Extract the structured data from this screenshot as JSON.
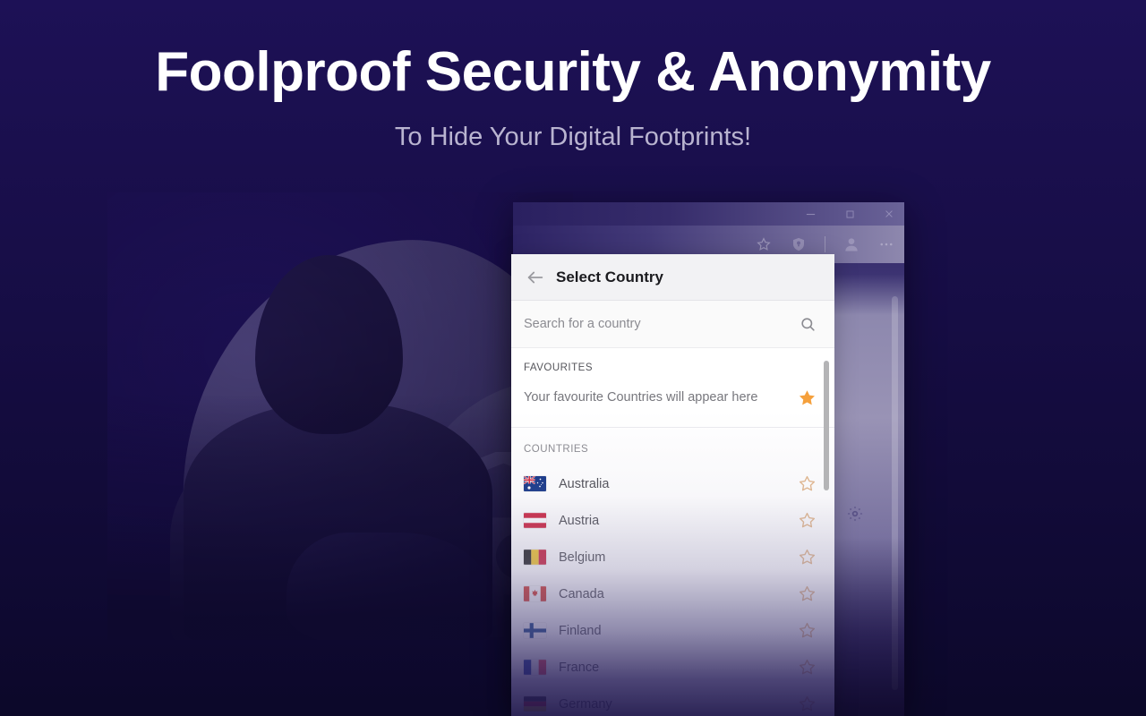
{
  "hero": {
    "title": "Foolproof Security & Anonymity",
    "subtitle": "To Hide Your Digital Footprints!"
  },
  "colors": {
    "background_top": "#1d1156",
    "background_bottom": "#0c0829",
    "star_filled": "#f5a03c",
    "star_empty": "#e0b183",
    "panel_background": "#ffffff",
    "header_background": "#f2f2f4"
  },
  "browser": {
    "window_controls": [
      {
        "name": "minimize",
        "glyph": "–"
      },
      {
        "name": "maximize",
        "glyph": "❐"
      },
      {
        "name": "close",
        "glyph": "✕"
      }
    ],
    "toolbar_icons": [
      "star-icon",
      "shield-icon",
      "profile-icon",
      "more-icon"
    ],
    "page_icons": [
      "gear-icon"
    ]
  },
  "panel": {
    "title": "Select Country",
    "back_label": "Back",
    "search": {
      "placeholder": "Search for a country",
      "value": ""
    },
    "favourites": {
      "label": "FAVOURITES",
      "empty_text": "Your favourite Countries will appear here",
      "star_state": "filled"
    },
    "countries": {
      "label": "COUNTRIES",
      "items": [
        {
          "name": "Australia",
          "flag": "au",
          "favourite": false
        },
        {
          "name": "Austria",
          "flag": "at",
          "favourite": false
        },
        {
          "name": "Belgium",
          "flag": "be",
          "favourite": false
        },
        {
          "name": "Canada",
          "flag": "ca",
          "favourite": false
        },
        {
          "name": "Finland",
          "flag": "fi",
          "favourite": false
        },
        {
          "name": "France",
          "flag": "fr",
          "favourite": false
        },
        {
          "name": "Germany",
          "flag": "de",
          "favourite": false
        }
      ]
    }
  }
}
